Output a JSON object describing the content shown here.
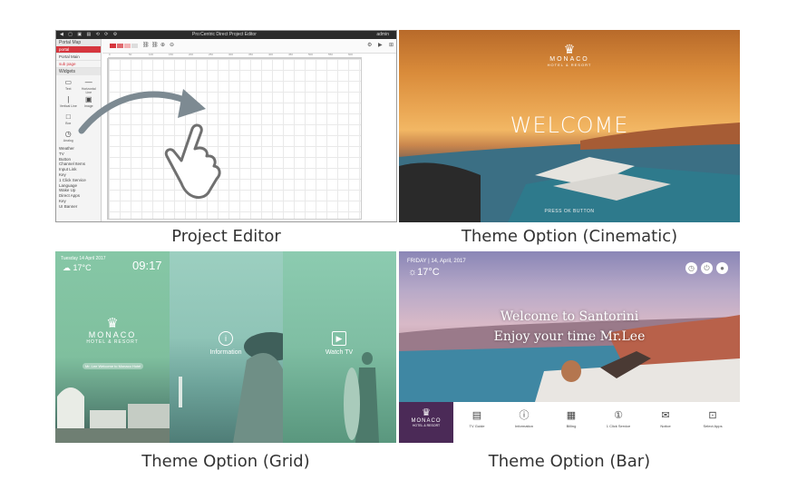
{
  "captions": {
    "editor": "Project Editor",
    "cinematic": "Theme Option (Cinematic)",
    "grid": "Theme Option (Grid)",
    "bar": "Theme Option (Bar)"
  },
  "editor": {
    "window_title": "Pro:Centric Direct Project Editor",
    "toolbar_right": "admin",
    "side_header": "Portal Map",
    "side_rows": [
      "portal",
      "Portal Main",
      "sub page"
    ],
    "widgets_header": "Widgets",
    "widgets": [
      {
        "icon": "text-icon",
        "glyph": "▭",
        "label": "Text"
      },
      {
        "icon": "line-icon",
        "glyph": "—",
        "label": "Horizontal Line"
      },
      {
        "icon": "vline-icon",
        "glyph": "|",
        "label": "Vertical Line"
      },
      {
        "icon": "tv-icon",
        "glyph": "▣",
        "label": "Image"
      },
      {
        "icon": "box-icon",
        "glyph": "□",
        "label": "Box"
      },
      {
        "icon": "blank-icon",
        "glyph": "",
        "label": ""
      },
      {
        "icon": "clock-icon",
        "glyph": "◷",
        "label": "Analog"
      },
      {
        "icon": "blank-icon",
        "glyph": "",
        "label": ""
      }
    ],
    "widget_list": [
      "Weather",
      "TV",
      "Button",
      "Channel Items",
      "Input Link",
      "Key",
      "1 Click Service",
      "Language",
      "Wake Up",
      "Direct Apps",
      "Key",
      "UI Banner"
    ],
    "ruler": [
      "0",
      "50",
      "100",
      "150",
      "200",
      "250",
      "300",
      "350",
      "400",
      "450",
      "500",
      "550",
      "600"
    ],
    "accent": "#d6363e"
  },
  "cinematic": {
    "brand": "MONACO",
    "brand_sub": "HOTEL & RESORT",
    "welcome": "WELCOME",
    "press": "PRESS OK BUTTON"
  },
  "grid": {
    "weather": "Tuesday 14 April 2017",
    "temp": "17°C",
    "time": "09:17",
    "brand": "MONACO",
    "brand_sub": "HOTEL & RESORT",
    "welcome_pill": "Mr. Lee Welcome to Monaco Hotel",
    "tiles": [
      {
        "icon": "info-icon",
        "label": "Information"
      },
      {
        "icon": "play-icon",
        "label": "Watch TV"
      }
    ]
  },
  "bar": {
    "date": "FRIDAY | 14, April, 2017",
    "temp": "17°C",
    "welcome_1": "Welcome to Santorini",
    "welcome_2": "Enjoy your time Mr.Lee",
    "brand": "MONACO",
    "brand_sub": "HOTEL & RESORT",
    "items": [
      {
        "icon": "tv-guide-icon",
        "glyph": "▤",
        "label": "TV Guide"
      },
      {
        "icon": "information-icon",
        "glyph": "ⓘ",
        "label": "Information"
      },
      {
        "icon": "billing-icon",
        "glyph": "▦",
        "label": "Billing"
      },
      {
        "icon": "one-click-icon",
        "glyph": "①",
        "label": "1 Click Service"
      },
      {
        "icon": "notice-icon",
        "glyph": "💬",
        "label": "Notice"
      },
      {
        "icon": "apps-icon",
        "glyph": "⊡",
        "label": "Select Apps"
      }
    ]
  }
}
